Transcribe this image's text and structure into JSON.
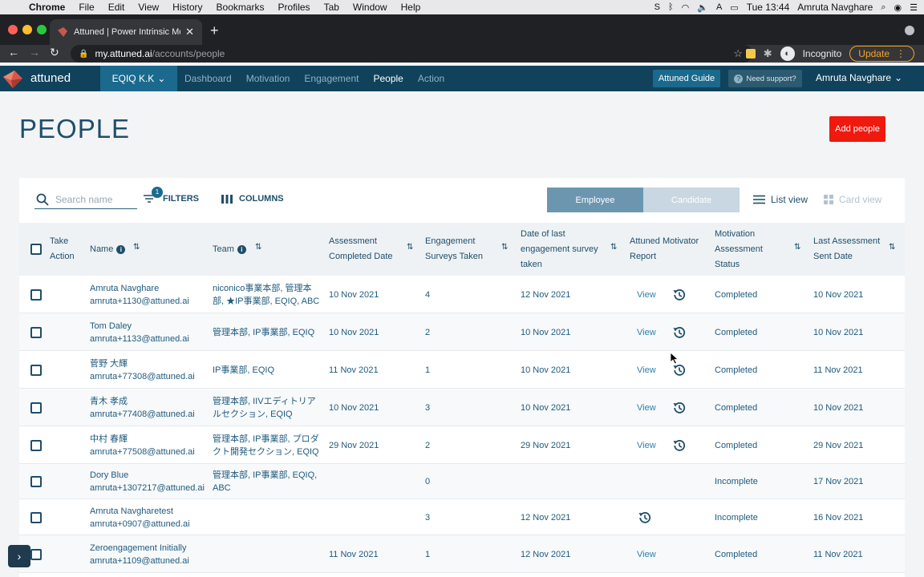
{
  "menubar": {
    "app": "Chrome",
    "items": [
      "File",
      "Edit",
      "View",
      "History",
      "Bookmarks",
      "Profiles",
      "Tab",
      "Window",
      "Help"
    ],
    "clock": "Tue 13:44",
    "user": "Amruta Navghare"
  },
  "browser": {
    "tab_title": "Attuned | Power Intrinsic Motiv",
    "url_domain": "my.attuned.ai",
    "url_path": "/accounts/people",
    "incognito_label": "Incognito",
    "update_label": "Update"
  },
  "app": {
    "logo_text": "attuned",
    "org": "EQIQ K.K",
    "nav": [
      "Dashboard",
      "Motivation",
      "Engagement",
      "People",
      "Action"
    ],
    "active_nav": "People",
    "guide": "Attuned Guide",
    "support": "Need support?",
    "user": "Amruta Navghare"
  },
  "page": {
    "title": "PEOPLE",
    "add_button": "Add people"
  },
  "toolbar": {
    "search_placeholder": "Search name",
    "filters_label": "FILTERS",
    "filters_count": "1",
    "columns_label": "COLUMNS",
    "employee_label": "Employee",
    "candidate_label": "Candidate",
    "list_view": "List view",
    "card_view": "Card view"
  },
  "table": {
    "headers": {
      "take_action": [
        "Take",
        "Action"
      ],
      "name": "Name",
      "team": "Team",
      "assessment_completed": [
        "Assessment",
        "Completed Date"
      ],
      "engagement_surveys": [
        "Engagement",
        "Surveys Taken"
      ],
      "date_last_engagement": [
        "Date of last",
        "engagement survey",
        "taken"
      ],
      "motivator_report": [
        "Attuned Motivator",
        "Report"
      ],
      "assessment_status": [
        "Motivation",
        "Assessment",
        "Status"
      ],
      "last_sent": [
        "Last Assessment",
        "Sent Date"
      ]
    },
    "rows": [
      {
        "name": "Amruta Navghare",
        "email": "amruta+1130@attuned.ai",
        "team": [
          "niconico事業本部, 管理本",
          "部, ★IP事業部, EQIQ, ABC"
        ],
        "completed": "10 Nov 2021",
        "surveys": "4",
        "last_survey": "12 Nov 2021",
        "view": "View",
        "history": true,
        "status": "Completed",
        "sent": "10 Nov 2021"
      },
      {
        "name": "Tom Daley",
        "email": "amruta+1133@attuned.ai",
        "team": [
          "管理本部, IP事業部, EQIQ"
        ],
        "completed": "10 Nov 2021",
        "surveys": "2",
        "last_survey": "10 Nov 2021",
        "view": "View",
        "history": true,
        "status": "Completed",
        "sent": "10 Nov 2021"
      },
      {
        "name": "菅野 大輝",
        "email": "amruta+77308@attuned.ai",
        "team": [
          "IP事業部, EQIQ"
        ],
        "completed": "11 Nov 2021",
        "surveys": "1",
        "last_survey": "10 Nov 2021",
        "view": "View",
        "history": true,
        "status": "Completed",
        "sent": "11 Nov 2021"
      },
      {
        "name": "青木 孝成",
        "email": "amruta+77408@attuned.ai",
        "team": [
          "管理本部, IIVエディトリア",
          "ルセクション, EQIQ"
        ],
        "completed": "10 Nov 2021",
        "surveys": "3",
        "last_survey": "10 Nov 2021",
        "view": "View",
        "history": true,
        "status": "Completed",
        "sent": "10 Nov 2021"
      },
      {
        "name": "中村 春輝",
        "email": "amruta+77508@attuned.ai",
        "team": [
          "管理本部, IP事業部, プロダ",
          "クト開発セクション, EQIQ"
        ],
        "completed": "29 Nov 2021",
        "surveys": "2",
        "last_survey": "29 Nov 2021",
        "view": "View",
        "history": true,
        "status": "Completed",
        "sent": "29 Nov 2021"
      },
      {
        "name": "Dory Blue",
        "email": "amruta+1307217@attuned.ai",
        "team": [
          "管理本部, IP事業部, EQIQ,",
          "ABC"
        ],
        "completed": "",
        "surveys": "0",
        "last_survey": "",
        "view": "",
        "history": false,
        "status": "Incomplete",
        "sent": "17 Nov 2021"
      },
      {
        "name": "Amruta Navgharetest",
        "email": "amruta+0907@attuned.ai",
        "team": [],
        "completed": "",
        "surveys": "3",
        "last_survey": "12 Nov 2021",
        "view": "",
        "history": true,
        "status": "Incomplete",
        "sent": "16 Nov 2021"
      },
      {
        "name": "Zeroengagement Initially",
        "email": "amruta+1109@attuned.ai",
        "team": [],
        "completed": "11 Nov 2021",
        "surveys": "1",
        "last_survey": "12 Nov 2021",
        "view": "View",
        "history": false,
        "status": "Completed",
        "sent": "11 Nov 2021"
      }
    ]
  },
  "colors": {
    "appbar": "#10425c",
    "accent": "#1b6a8e",
    "add_button": "#f0190f",
    "link": "#2b7fb0"
  }
}
